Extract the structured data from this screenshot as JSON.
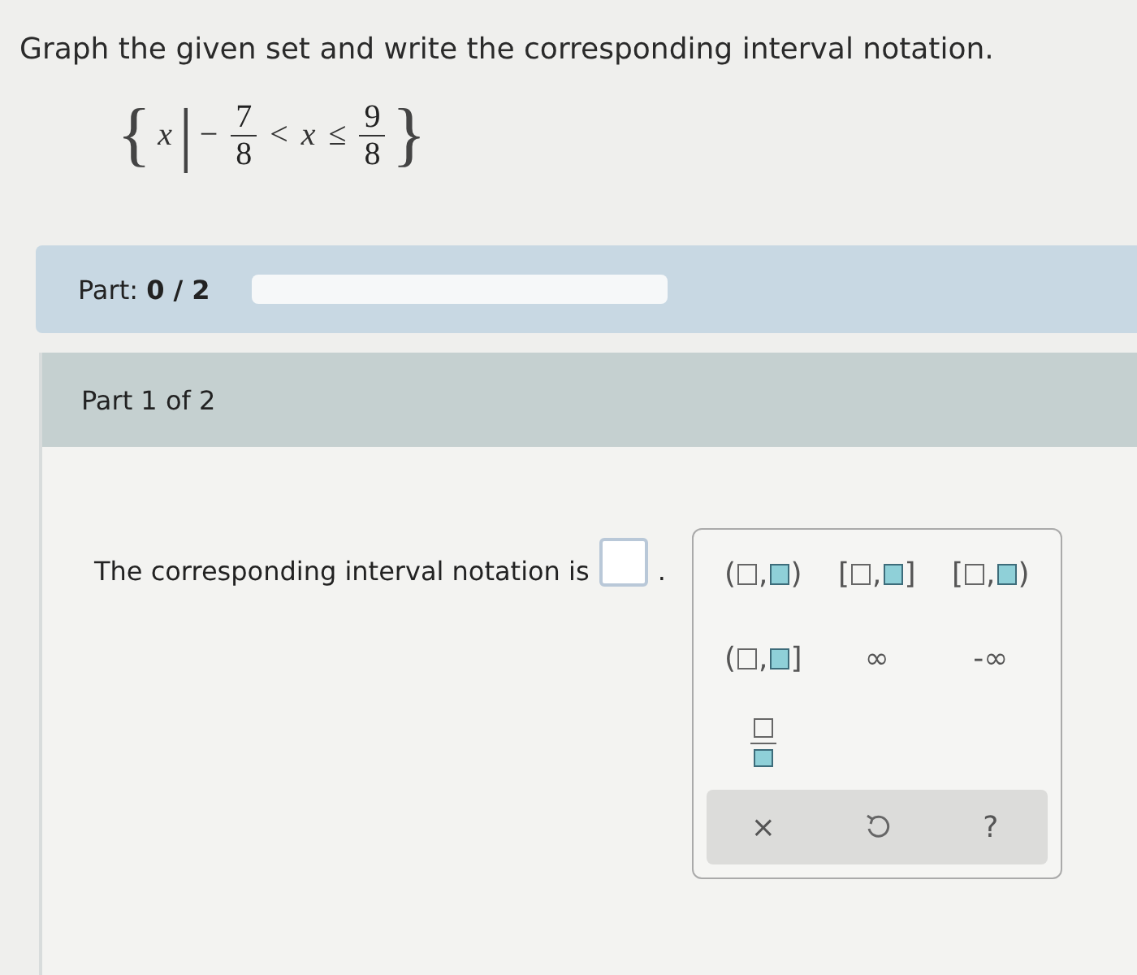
{
  "instruction": "Graph the given set and write the corresponding interval notation.",
  "set": {
    "open": "{",
    "var": "x",
    "bar": "|",
    "sign": "−",
    "lower": {
      "num": "7",
      "den": "8"
    },
    "op1": "<",
    "mid": "x",
    "op2": "≤",
    "upper": {
      "num": "9",
      "den": "8"
    },
    "close": "}"
  },
  "progress": {
    "label": "Part: **0 / 2**",
    "level": 0
  },
  "part_header": "Part 1 of 2",
  "question": {
    "prompt": "The corresponding interval notation is",
    "end": "."
  },
  "palette": {
    "buttons": [
      {
        "kind": "interval",
        "left": "(",
        "sep": ",",
        "right": ")"
      },
      {
        "kind": "interval",
        "left": "[",
        "sep": ",",
        "right": "]"
      },
      {
        "kind": "interval",
        "left": "[",
        "sep": ",",
        "right": ")"
      },
      {
        "kind": "interval",
        "left": "(",
        "sep": ",",
        "right": "]"
      },
      {
        "kind": "symbol",
        "text": "∞"
      },
      {
        "kind": "symbol",
        "text": "-∞"
      },
      {
        "kind": "fraction"
      }
    ],
    "actions": [
      {
        "kind": "text",
        "text": "×"
      },
      {
        "kind": "undo"
      },
      {
        "kind": "text",
        "text": "?"
      }
    ]
  }
}
